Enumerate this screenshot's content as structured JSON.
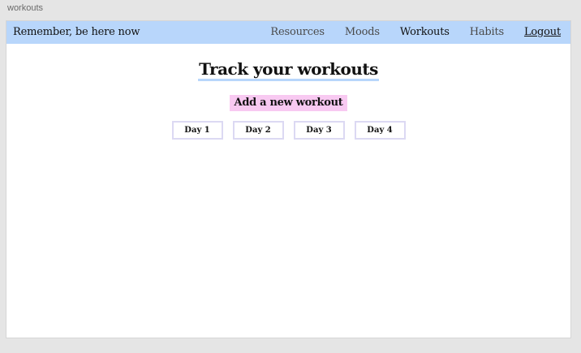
{
  "canvas": {
    "label": "workouts"
  },
  "navbar": {
    "brand": "Remember, be here now",
    "links": [
      {
        "label": "Resources"
      },
      {
        "label": "Moods"
      },
      {
        "label": "Workouts"
      },
      {
        "label": "Habits"
      }
    ],
    "logout": "Logout"
  },
  "main": {
    "title": "Track your workouts",
    "add_button": "Add a new workout",
    "days": [
      {
        "label": "Day 1"
      },
      {
        "label": "Day 2"
      },
      {
        "label": "Day 3"
      },
      {
        "label": "Day 4"
      }
    ]
  },
  "colors": {
    "navbar_bg": "#b8d6fb",
    "add_button_bg": "#f8c9f1",
    "day_border": "#dcd9f3"
  }
}
